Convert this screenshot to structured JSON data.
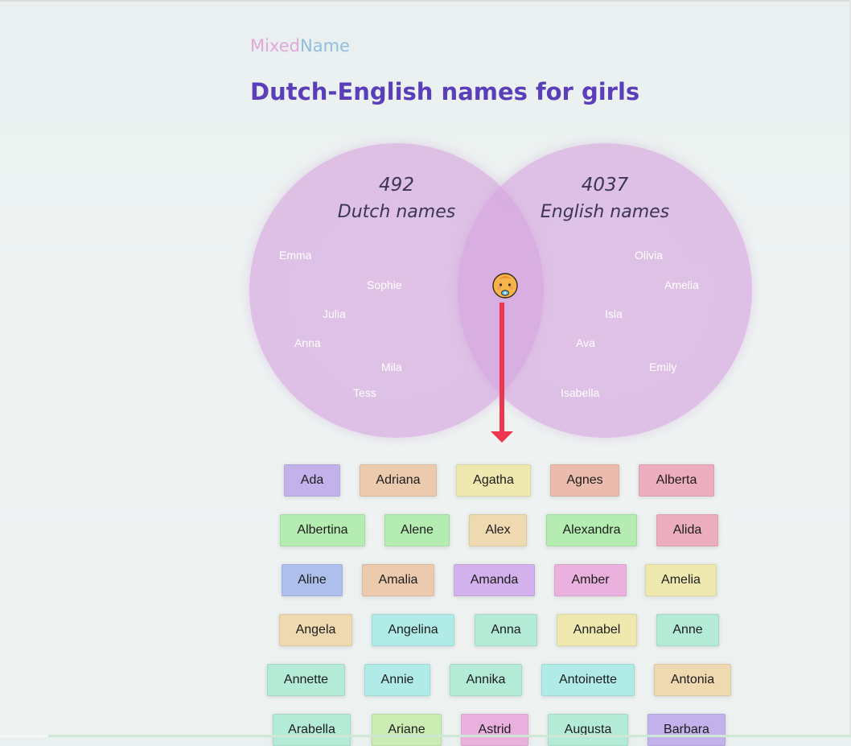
{
  "brand": {
    "part1": "Mixed",
    "part2": "Name"
  },
  "title": "Dutch-English names for girls",
  "venn": {
    "left": {
      "count": "492",
      "label": "Dutch names",
      "names": [
        "Emma",
        "Sophie",
        "Julia",
        "Anna",
        "Mila",
        "Tess"
      ]
    },
    "right": {
      "count": "4037",
      "label": "English names",
      "names": [
        "Olivia",
        "Amelia",
        "Isla",
        "Ava",
        "Emily",
        "Isabella"
      ]
    },
    "center_icon": "baby-face-icon",
    "arrow_icon": "arrow-down-icon",
    "arrow_color": "#f0364e"
  },
  "names": [
    [
      "Ada",
      "Adriana",
      "Agatha",
      "Agnes",
      "Alberta"
    ],
    [
      "Albertina",
      "Alene",
      "Alex",
      "Alexandra",
      "Alida"
    ],
    [
      "Aline",
      "Amalia",
      "Amanda",
      "Amber",
      "Amelia"
    ],
    [
      "Angela",
      "Angelina",
      "Anna",
      "Annabel",
      "Anne"
    ],
    [
      "Annette",
      "Annie",
      "Annika",
      "Antoinette",
      "Antonia"
    ],
    [
      "Arabella",
      "Ariane",
      "Astrid",
      "Augusta",
      "Barbara"
    ]
  ],
  "chip_colors": {
    "purple": "#c3b1ec",
    "peach": "#eccaae",
    "yellow": "#efe9b0",
    "salmon": "#ebbcae",
    "pink": "#ecaebe",
    "green": "#b4ecb2",
    "blue": "#aebfec",
    "violet": "#d3b1ec",
    "magenta": "#ebb1de",
    "teal": "#b0ebe8",
    "mint": "#b3ebd6",
    "lime": "#cbecb2",
    "tan": "#efd9b0"
  }
}
